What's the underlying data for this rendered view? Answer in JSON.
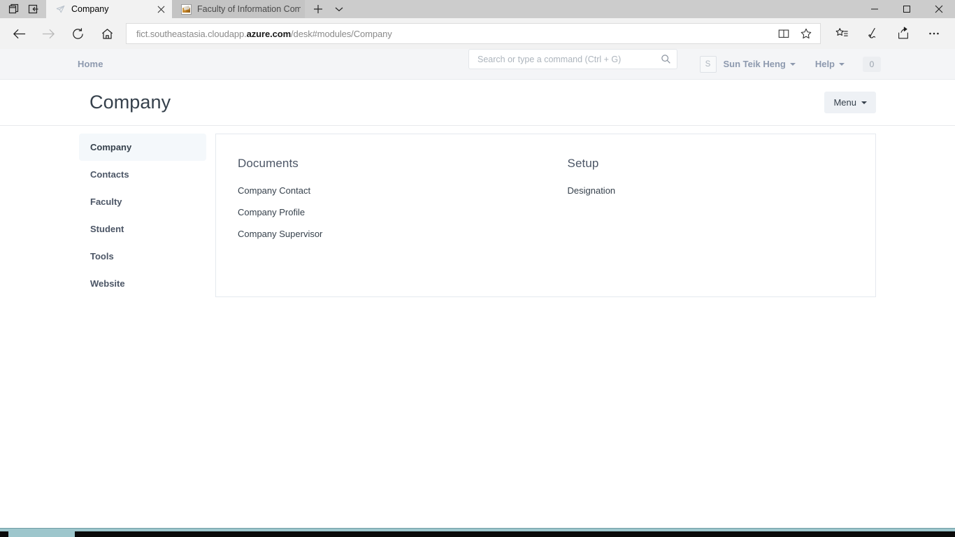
{
  "browser": {
    "chrome_icons": {
      "tabs_preview": "tabs-preview-icon",
      "set_aside": "set-aside-tabs-icon",
      "new_tab": "new-tab-icon",
      "tab_list": "tab-list-chevron-icon"
    },
    "tabs": [
      {
        "title": "Company",
        "favicon": "frappe-send-icon",
        "active": true,
        "has_close": true
      },
      {
        "title": "Faculty of Information Comm",
        "favicon": "site-image-icon",
        "active": false,
        "has_close": false
      }
    ],
    "window_controls": {
      "minimize": "—",
      "maximize": "☐",
      "close": "✕"
    },
    "nav": {
      "back": "back-arrow-icon",
      "forward": "forward-arrow-icon",
      "refresh": "refresh-icon",
      "home": "home-icon"
    },
    "address": {
      "prefix": "fict.southeastasia.cloudapp.",
      "domain": "azure.com",
      "suffix": "/desk#modules/Company",
      "full": "fict.southeastasia.cloudapp.azure.com/desk#modules/Company"
    },
    "address_icons": {
      "reading_view": "reading-view-icon",
      "favorite": "star-icon"
    },
    "toolbar_icons": {
      "hub": "favorites-hub-icon",
      "web_note": "web-note-pen-icon",
      "share": "share-icon",
      "settings": "more-ellipsis-icon"
    }
  },
  "app": {
    "navbar": {
      "home_label": "Home",
      "search": {
        "placeholder": "Search or type a command (Ctrl + G)",
        "value": "",
        "icon": "search-icon"
      },
      "avatar_initial": "S",
      "user_name": "Sun Teik Heng",
      "help_label": "Help",
      "badge_count": "0"
    },
    "page": {
      "title": "Company",
      "menu_label": "Menu"
    },
    "sidebar": {
      "items": [
        {
          "label": "Company",
          "active": true
        },
        {
          "label": "Contacts",
          "active": false
        },
        {
          "label": "Faculty",
          "active": false
        },
        {
          "label": "Student",
          "active": false
        },
        {
          "label": "Tools",
          "active": false
        },
        {
          "label": "Website",
          "active": false
        }
      ]
    },
    "module_sections": [
      {
        "heading": "Documents",
        "links": [
          "Company Contact",
          "Company Profile",
          "Company Supervisor"
        ]
      },
      {
        "heading": "Setup",
        "links": [
          "Designation"
        ]
      }
    ]
  },
  "colors": {
    "accent_muted": "#8d99ae",
    "text_dark": "#36414c",
    "sidebar_active_bg": "#f4f8fb",
    "navbar_bg": "#f4f5f7",
    "card_border": "#e5e9ee",
    "taskbar_teal": "#9dc6cc"
  }
}
